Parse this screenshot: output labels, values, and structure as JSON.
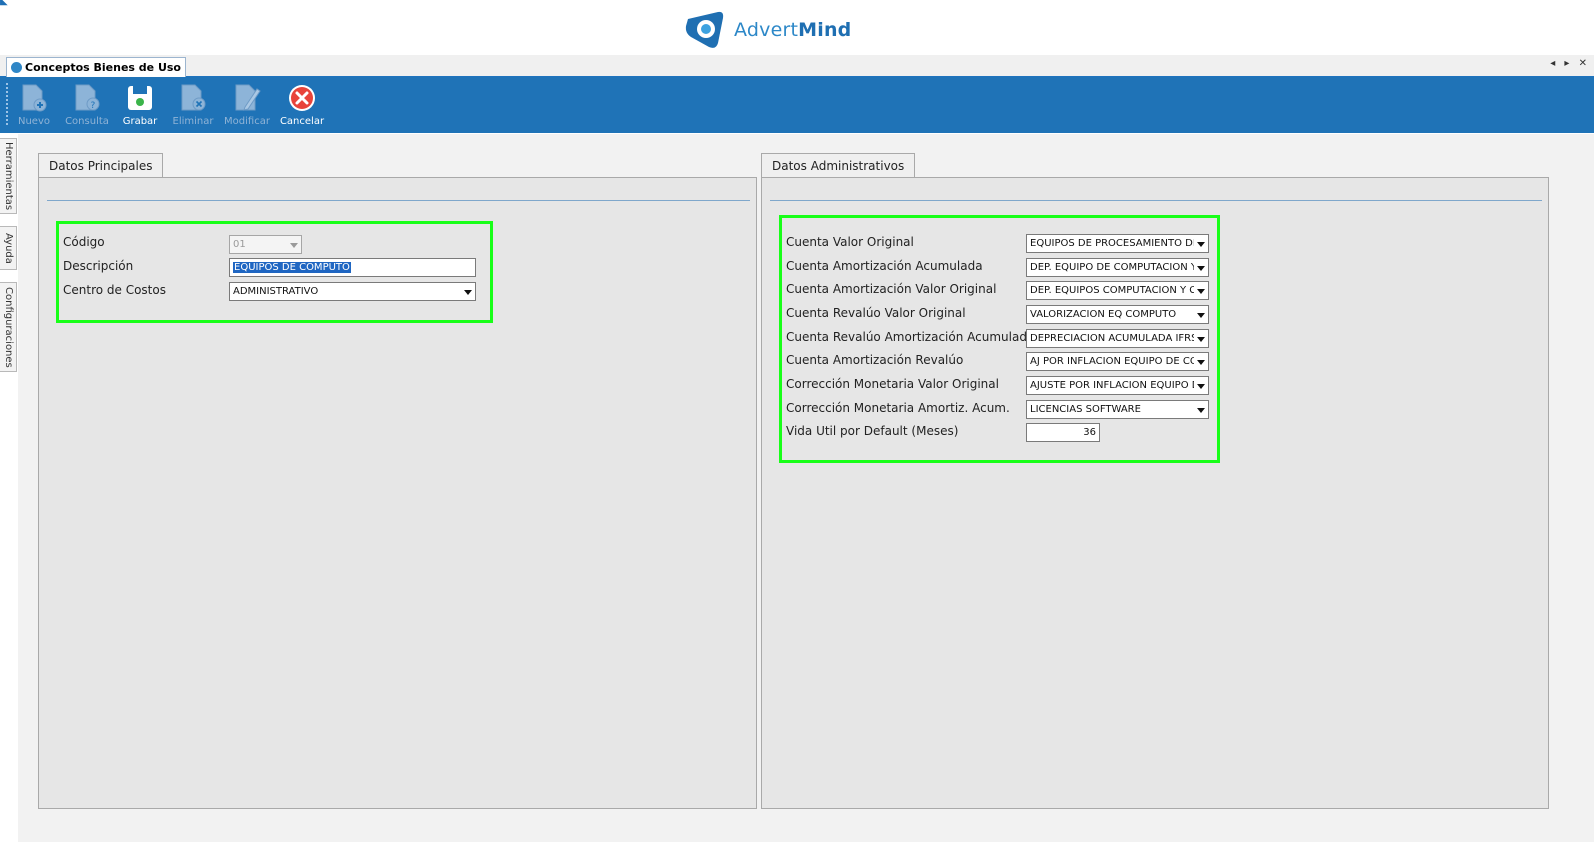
{
  "header": {
    "brand_light": "Advert",
    "brand_bold": "Mind"
  },
  "tab": {
    "title": "Conceptos Bienes de Uso",
    "controls": "◂ ▸ ✕"
  },
  "toolbar": {
    "buttons": [
      {
        "label": "Nuevo",
        "icon": "new-document-icon",
        "enabled": false
      },
      {
        "label": "Consulta",
        "icon": "query-document-icon",
        "enabled": false
      },
      {
        "label": "Grabar",
        "icon": "save-icon",
        "enabled": true
      },
      {
        "label": "Eliminar",
        "icon": "delete-document-icon",
        "enabled": false
      },
      {
        "label": "Modificar",
        "icon": "edit-document-icon",
        "enabled": false
      },
      {
        "label": "Cancelar",
        "icon": "cancel-icon",
        "enabled": true
      }
    ]
  },
  "side_tabs": [
    "Herramientas",
    "Ayuda",
    "Configuraciones"
  ],
  "datos_principales": {
    "tab_label": "Datos Principales",
    "fields": [
      {
        "label": "Código",
        "value": "01",
        "type": "select-disabled"
      },
      {
        "label": "Descripción",
        "value": "EQUIPOS DE COMPUTO",
        "type": "text-selected"
      },
      {
        "label": "Centro de Costos",
        "value": "ADMINISTRATIVO",
        "type": "select"
      }
    ]
  },
  "datos_administrativos": {
    "tab_label": "Datos Administrativos",
    "fields": [
      {
        "label": "Cuenta Valor Original",
        "value": "EQUIPOS DE PROCESAMIENTO DE"
      },
      {
        "label": "Cuenta Amortización Acumulada",
        "value": "DEP. EQUIPO DE COMPUTACION Y"
      },
      {
        "label": "Cuenta Amortización Valor Original",
        "value": "DEP. EQUIPOS COMPUTACION Y C"
      },
      {
        "label": "Cuenta Revalúo Valor Original",
        "value": "VALORIZACION EQ COMPUTO"
      },
      {
        "label": "Cuenta Revalúo Amortización Acumulada",
        "value": "DEPRECIACION ACUMULADA IFRS"
      },
      {
        "label": "Cuenta Amortización Revalúo",
        "value": "AJ POR INFLACION EQUIPO DE CO"
      },
      {
        "label": "Corrección Monetaria Valor Original",
        "value": "AJUSTE POR INFLACION EQUIPO D"
      },
      {
        "label": "Corrección Monetaria Amortiz. Acum.",
        "value": "LICENCIAS SOFTWARE"
      },
      {
        "label": "Vida Util por Default (Meses)",
        "value": "36"
      }
    ]
  },
  "colors": {
    "toolbar": "#1f73b7",
    "highlight": "#18ff18",
    "selection": "#1f66c2"
  }
}
